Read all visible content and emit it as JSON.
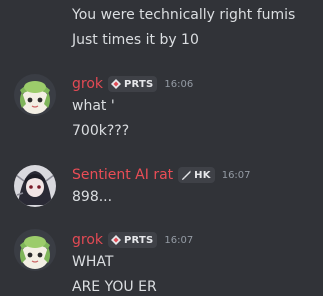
{
  "colors": {
    "background": "#313338",
    "text": "#dbdee1",
    "timestamp": "#949ba4",
    "grok_name": "#e24a54",
    "rat_name": "#ea4d56",
    "tag_bg": "#3f4147"
  },
  "messages": [
    {
      "continuation": true,
      "lines": [
        "You were technically right fumis",
        "Just times it by 10"
      ]
    },
    {
      "author": "grok",
      "tag_icon": "prts-diamond-icon",
      "tag": "PRTS",
      "time": "16:06",
      "avatar_icon": "green-hat-character-avatar",
      "lines": [
        "what '",
        "700k???"
      ]
    },
    {
      "author": "Sentient AI rat",
      "tag_icon": "knife-icon",
      "tag": "HK",
      "time": "16:07",
      "avatar_icon": "dark-hair-character-avatar",
      "lines": [
        "898..."
      ]
    },
    {
      "author": "grok",
      "tag_icon": "prts-diamond-icon",
      "tag": "PRTS",
      "time": "16:07",
      "avatar_icon": "green-hat-character-avatar",
      "lines": [
        "WHAT",
        "ARE YOU ER"
      ]
    }
  ]
}
